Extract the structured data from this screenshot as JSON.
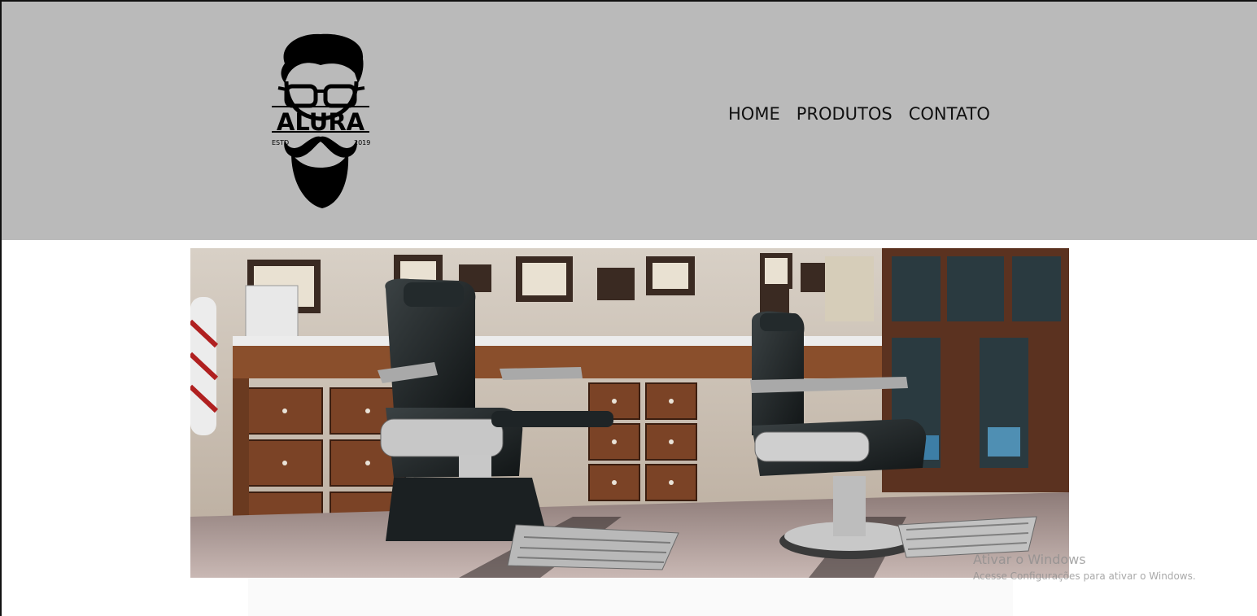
{
  "header": {
    "background": "#bababa",
    "logo": {
      "brand_text": "ALURA",
      "estd_label": "ESTD",
      "year_label": "2019",
      "icon": "bearded-man-logo-icon"
    },
    "nav": [
      {
        "label": "HOME"
      },
      {
        "label": "PRODUTOS"
      },
      {
        "label": "CONTATO"
      }
    ]
  },
  "banner": {
    "icon": "barbershop-chairs-photo"
  },
  "watermark": {
    "line1": "Ativar o Windows",
    "line2": "Acesse Configurações para ativar o Windows."
  }
}
